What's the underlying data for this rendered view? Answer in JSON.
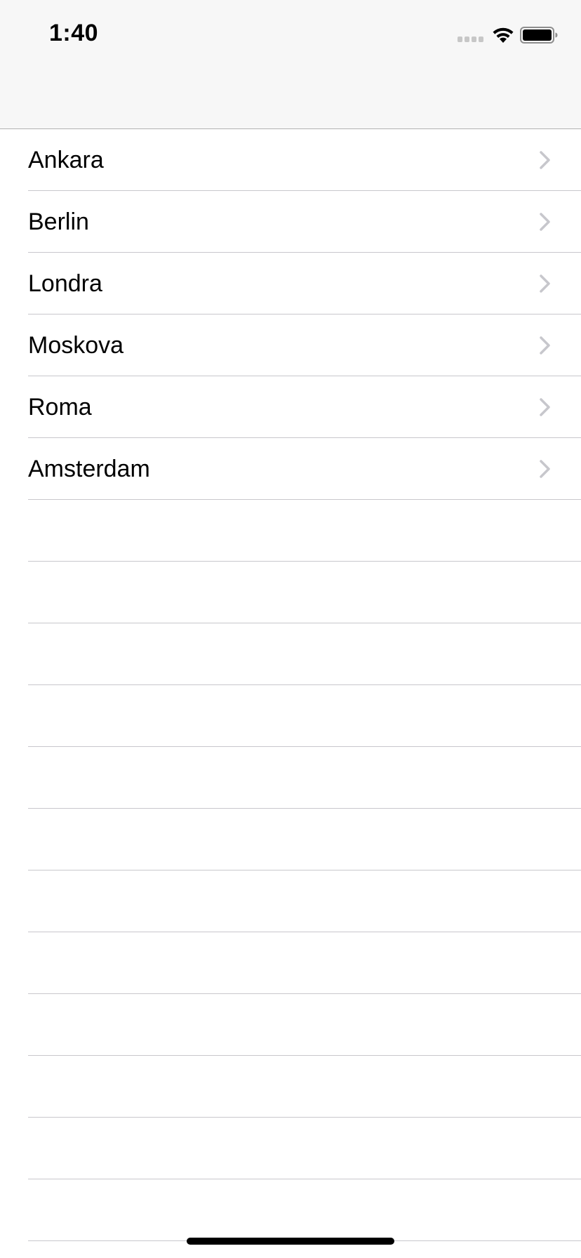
{
  "status_bar": {
    "time": "1:40",
    "signal_icon": "cellular-signal-icon",
    "wifi_icon": "wifi-icon",
    "battery_icon": "battery-icon"
  },
  "list": {
    "items": [
      {
        "label": "Ankara"
      },
      {
        "label": "Berlin"
      },
      {
        "label": "Londra"
      },
      {
        "label": "Moskova"
      },
      {
        "label": "Roma"
      },
      {
        "label": "Amsterdam"
      }
    ],
    "accessory_icon": "chevron-right-icon"
  },
  "colors": {
    "navbar_background": "#f7f7f7",
    "separator": "#c8c7cc",
    "chevron": "#c7c7cc",
    "text": "#000000"
  }
}
